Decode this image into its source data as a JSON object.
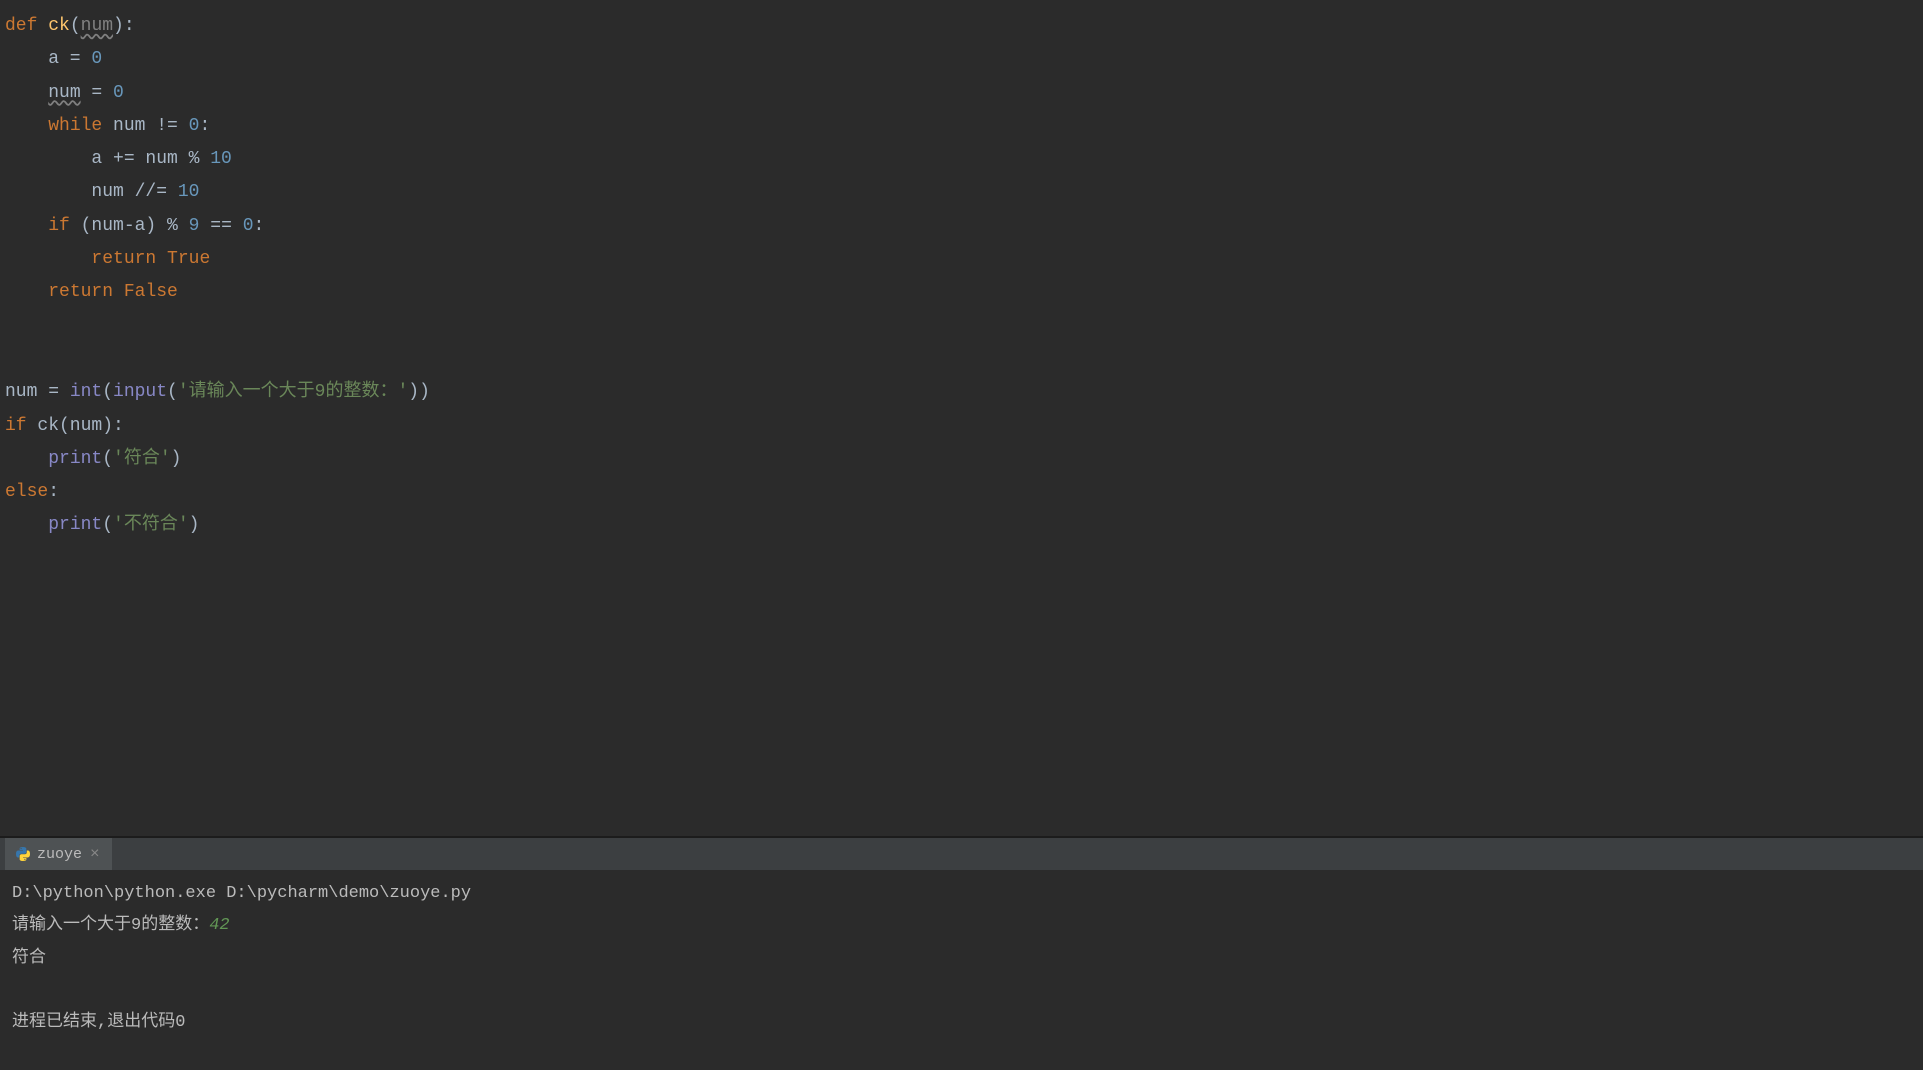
{
  "code": {
    "lines": [
      {
        "tokens": [
          {
            "t": "def ",
            "c": "kw"
          },
          {
            "t": "ck",
            "c": "fn"
          },
          {
            "t": "("
          },
          {
            "t": "num",
            "c": "param underline"
          },
          {
            "t": "):"
          }
        ]
      },
      {
        "indent": 1,
        "tokens": [
          {
            "t": "a = "
          },
          {
            "t": "0",
            "c": "num"
          }
        ]
      },
      {
        "indent": 1,
        "tokens": [
          {
            "t": "num",
            "c": "underline"
          },
          {
            "t": " = "
          },
          {
            "t": "0",
            "c": "num"
          }
        ]
      },
      {
        "indent": 1,
        "tokens": [
          {
            "t": "while ",
            "c": "kw"
          },
          {
            "t": "num != "
          },
          {
            "t": "0",
            "c": "num"
          },
          {
            "t": ":"
          }
        ]
      },
      {
        "indent": 2,
        "tokens": [
          {
            "t": "a += num % "
          },
          {
            "t": "10",
            "c": "num"
          }
        ]
      },
      {
        "indent": 2,
        "tokens": [
          {
            "t": "num //= "
          },
          {
            "t": "10",
            "c": "num"
          }
        ]
      },
      {
        "indent": 1,
        "tokens": [
          {
            "t": "if ",
            "c": "kw"
          },
          {
            "t": "(num-a) % "
          },
          {
            "t": "9",
            "c": "num"
          },
          {
            "t": " == "
          },
          {
            "t": "0",
            "c": "num"
          },
          {
            "t": ":"
          }
        ]
      },
      {
        "indent": 2,
        "tokens": [
          {
            "t": "return ",
            "c": "kw"
          },
          {
            "t": "True",
            "c": "kw"
          }
        ]
      },
      {
        "indent": 1,
        "tokens": [
          {
            "t": "return ",
            "c": "kw"
          },
          {
            "t": "False",
            "c": "kw"
          }
        ]
      },
      {
        "tokens": []
      },
      {
        "tokens": []
      },
      {
        "tokens": [
          {
            "t": "num = "
          },
          {
            "t": "int",
            "c": "builtin"
          },
          {
            "t": "("
          },
          {
            "t": "input",
            "c": "builtin"
          },
          {
            "t": "("
          },
          {
            "t": "'请输入一个大于9的整数：'",
            "c": "str"
          },
          {
            "t": "))"
          }
        ]
      },
      {
        "tokens": [
          {
            "t": "if ",
            "c": "kw"
          },
          {
            "t": "ck(num):"
          }
        ]
      },
      {
        "indent": 1,
        "tokens": [
          {
            "t": "print",
            "c": "builtin"
          },
          {
            "t": "("
          },
          {
            "t": "'符合'",
            "c": "str"
          },
          {
            "t": ")"
          }
        ]
      },
      {
        "tokens": [
          {
            "t": "else",
            "c": "kw"
          },
          {
            "t": ":"
          }
        ]
      },
      {
        "indent": 1,
        "tokens": [
          {
            "t": "print",
            "c": "builtin"
          },
          {
            "t": "("
          },
          {
            "t": "'不符合'",
            "c": "str"
          },
          {
            "t": ")"
          }
        ]
      }
    ]
  },
  "tab": {
    "name": "zuoye"
  },
  "terminal": {
    "lines": [
      {
        "parts": [
          {
            "t": "D:\\python\\python.exe D:\\pycharm\\demo\\zuoye.py"
          }
        ]
      },
      {
        "parts": [
          {
            "t": "请输入一个大于9的整数："
          },
          {
            "t": "42",
            "c": "term-input"
          }
        ]
      },
      {
        "parts": [
          {
            "t": "符合"
          }
        ]
      },
      {
        "parts": [
          {
            "t": ""
          }
        ]
      },
      {
        "parts": [
          {
            "t": "进程已结束,退出代码0"
          }
        ]
      }
    ]
  }
}
